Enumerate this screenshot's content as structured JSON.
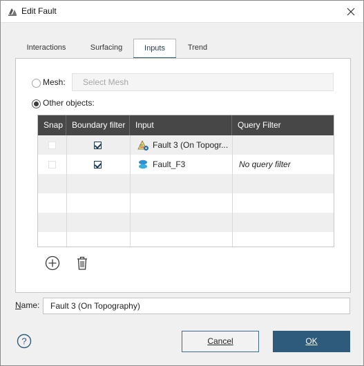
{
  "window": {
    "title": "Edit Fault"
  },
  "tabs": [
    {
      "label": "Interactions",
      "active": false
    },
    {
      "label": "Surfacing",
      "active": false
    },
    {
      "label": "Inputs",
      "active": true
    },
    {
      "label": "Trend",
      "active": false
    }
  ],
  "mesh": {
    "label": "Mesh:",
    "placeholder": "Select Mesh",
    "selected": false
  },
  "other_objects": {
    "label": "Other objects:",
    "selected": true
  },
  "table": {
    "columns": [
      "Snap",
      "Boundary filter",
      "Input",
      "Query Filter"
    ],
    "rows": [
      {
        "snap": false,
        "boundary_filter": true,
        "input": "Fault 3 (On Topogr...",
        "input_icon": "fault-surface-icon",
        "query_filter": ""
      },
      {
        "snap": false,
        "boundary_filter": true,
        "input": "Fault_F3",
        "input_icon": "fault-object-icon",
        "query_filter": "No query filter"
      }
    ]
  },
  "name": {
    "label": "Name:",
    "value": "Fault 3 (On Topography)"
  },
  "buttons": {
    "cancel": "Cancel",
    "ok": "OK",
    "help": "?"
  },
  "colors": {
    "accent": "#2e5a7c",
    "header_bg": "#474747"
  }
}
